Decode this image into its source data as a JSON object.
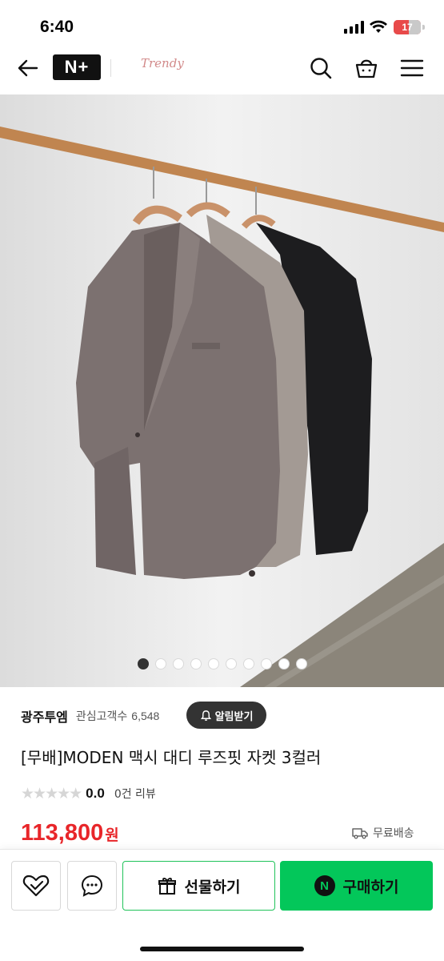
{
  "status_bar": {
    "time": "6:40",
    "battery": "17"
  },
  "nav": {
    "brand_logo_text": "Trendy"
  },
  "gallery": {
    "total_images": 10,
    "active_index": 0
  },
  "product": {
    "store_name": "광주투엠",
    "follower_label": "관심고객수",
    "follower_count": "6,548",
    "notify_label": "알림받기",
    "title": "[무배]MODEN 맥시 대디 루즈핏 자켓 3컬러",
    "stars": "★★★★★",
    "rating": "0.0",
    "review_count": "0건 리뷰",
    "price": "113,800",
    "price_unit": "원",
    "shipping": "무료배송"
  },
  "bottom_bar": {
    "gift_label": "선물하기",
    "buy_label": "구매하기",
    "buy_badge": "N"
  },
  "colors": {
    "accent_green": "#03c75a",
    "price_red": "#e8262a"
  }
}
